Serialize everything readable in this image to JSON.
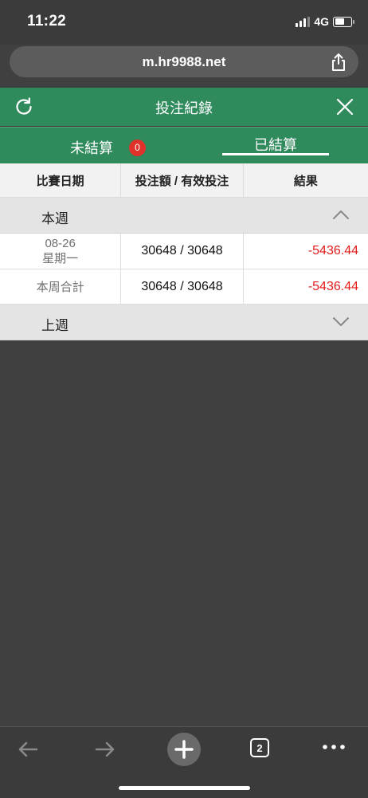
{
  "status_bar": {
    "time": "11:22",
    "network": "4G"
  },
  "browser": {
    "url": "m.hr9988.net",
    "tab_count": "2"
  },
  "header": {
    "title": "投注紀錄"
  },
  "tabs": {
    "unsettled_label": "未結算",
    "unsettled_count": "0",
    "settled_label": "已結算",
    "active": "settled"
  },
  "table": {
    "columns": [
      "比賽日期",
      "投注額 / 有效投注",
      "結果"
    ],
    "this_week": {
      "label": "本週",
      "rows": [
        {
          "date": "08-26",
          "weekday": "星期一",
          "amount": "30648 / 30648",
          "result": "-5436.44"
        }
      ],
      "summary": {
        "label": "本周合計",
        "amount": "30648 / 30648",
        "result": "-5436.44"
      }
    },
    "last_week": {
      "label": "上週"
    }
  },
  "colors": {
    "header_green": "#2f8a5c",
    "negative_red": "#e31b1b",
    "badge_red": "#e0322a"
  }
}
